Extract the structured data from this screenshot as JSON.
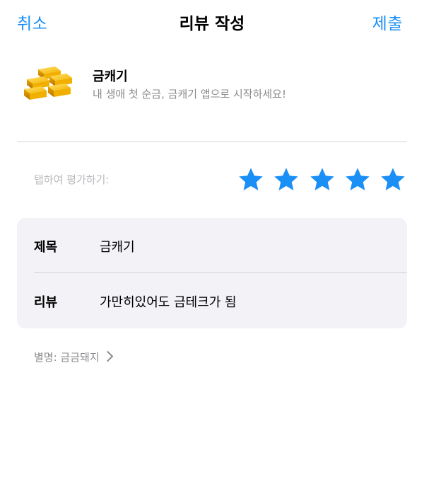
{
  "nav": {
    "cancel_label": "취소",
    "title": "리뷰 작성",
    "submit_label": "제출",
    "accent_color": "#1a8ff5"
  },
  "app": {
    "icon": "gold-bars-icon",
    "name": "금캐기",
    "tagline": "내 생애 첫 순금, 금캐기 앱으로 시작하세요!"
  },
  "rating": {
    "label": "탭하여 평가하기:",
    "value": 5,
    "max": 5,
    "star_color": "#1a8ff5"
  },
  "form": {
    "title_label": "제목",
    "title_value": "금캐기",
    "review_label": "리뷰",
    "review_value": "가만히있어도 금테크가 됨"
  },
  "nickname": {
    "text": "별명: 금금돼지",
    "icon": "chevron-right-icon"
  }
}
